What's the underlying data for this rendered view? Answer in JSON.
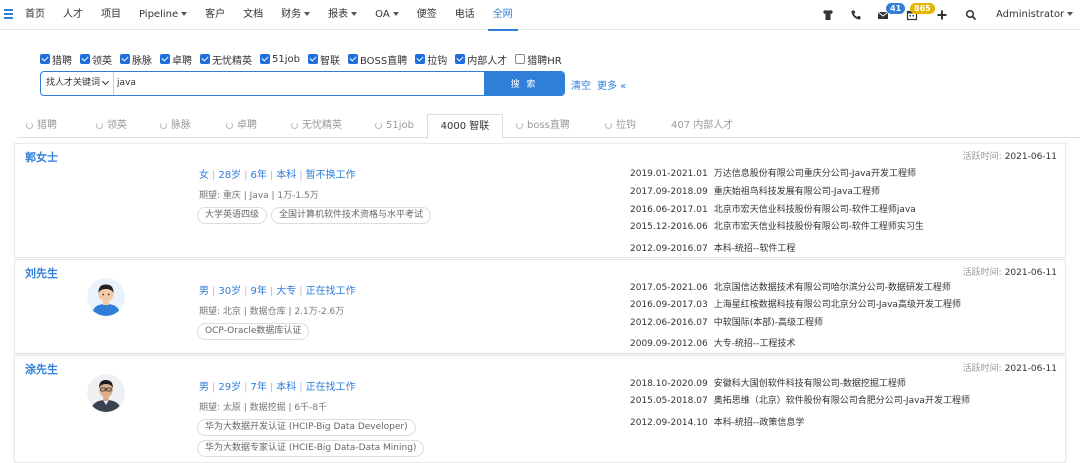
{
  "nav": {
    "items": [
      {
        "label": "首页",
        "caret": false
      },
      {
        "label": "人才",
        "caret": false
      },
      {
        "label": "项目",
        "caret": false
      },
      {
        "label": "Pipeline",
        "caret": true
      },
      {
        "label": "客户",
        "caret": false
      },
      {
        "label": "文档",
        "caret": false
      },
      {
        "label": "财务",
        "caret": true
      },
      {
        "label": "报表",
        "caret": true
      },
      {
        "label": "OA",
        "caret": true
      },
      {
        "label": "便签",
        "caret": false
      },
      {
        "label": "电话",
        "caret": false
      },
      {
        "label": "全网",
        "caret": false,
        "active": true
      }
    ],
    "message_badge": "41",
    "calendar_badge": "865",
    "user": "Administrator",
    "accent_color": "#2f7ed8"
  },
  "sources": [
    {
      "label": "猎聘",
      "checked": true
    },
    {
      "label": "领英",
      "checked": true
    },
    {
      "label": "脉脉",
      "checked": true
    },
    {
      "label": "卓聘",
      "checked": true
    },
    {
      "label": "无忧精英",
      "checked": true
    },
    {
      "label": "51job",
      "checked": true
    },
    {
      "label": "智联",
      "checked": true
    },
    {
      "label": "BOSS直聘",
      "checked": true
    },
    {
      "label": "拉钩",
      "checked": true
    },
    {
      "label": "内部人才",
      "checked": true
    },
    {
      "label": "猎聘HR",
      "checked": false
    }
  ],
  "search": {
    "field_select": "找人才关键词",
    "keyword": "java",
    "button_label": "搜 索",
    "clear_label": "清空",
    "more_label": "更多 «"
  },
  "tabs": [
    {
      "label": "猎聘",
      "loading": true
    },
    {
      "label": "领英",
      "loading": true
    },
    {
      "label": "脉脉",
      "loading": true
    },
    {
      "label": "卓聘",
      "loading": true
    },
    {
      "label": "无忧精英",
      "loading": true
    },
    {
      "label": "51job",
      "loading": true
    },
    {
      "label": "4000 智联",
      "loading": false,
      "active": true
    },
    {
      "label": "boss直聘",
      "loading": true
    },
    {
      "label": "拉钩",
      "loading": true
    },
    {
      "label": "407 内部人才",
      "loading": false
    }
  ],
  "active_time_label": "活跃时间:",
  "candidates": [
    {
      "name": "郭女士",
      "avatar": "blank",
      "summary": [
        "女",
        "28岁",
        "6年",
        "本科",
        "暂不换工作"
      ],
      "expect": "期望: 重庆 | Java | 1万-1.5万",
      "tags": [
        "大学英语四级",
        "全国计算机软件技术资格与水平考试"
      ],
      "active_time": "2021-06-11",
      "experiences": [
        {
          "date": "2019.01-2021.01",
          "text": "万达信息股份有限公司重庆分公司-Java开发工程师"
        },
        {
          "date": "2017.09-2018.09",
          "text": "重庆始祖鸟科技发展有限公司-Java工程师"
        },
        {
          "date": "2016.06-2017.01",
          "text": "北京市宏天信业科技股份有限公司-软件工程师java"
        },
        {
          "date": "2015.12-2016.06",
          "text": "北京市宏天信业科技股份有限公司-软件工程师实习生"
        }
      ],
      "education": {
        "date": "2012.09-2016.07",
        "text": "本科-统招--软件工程"
      }
    },
    {
      "name": "刘先生",
      "avatar": "cartoon-male",
      "summary": [
        "男",
        "30岁",
        "9年",
        "大专",
        "正在找工作"
      ],
      "expect": "期望: 北京 | 数据仓库 | 2.1万-2.6万",
      "tags": [
        "OCP-Oracle数据库认证"
      ],
      "active_time": "2021-06-11",
      "experiences": [
        {
          "date": "2017.05-2021.06",
          "text": "北京国信达数据技术有限公司哈尔滨分公司-数据研发工程师"
        },
        {
          "date": "2016.09-2017.03",
          "text": "上海星红桉数据科技有限公司北京分公司-Java高级开发工程师"
        },
        {
          "date": "2012.06-2016.07",
          "text": "中软国际(本部)-高级工程师"
        }
      ],
      "education": {
        "date": "2009.09-2012.06",
        "text": "大专-统招--工程技术"
      }
    },
    {
      "name": "涂先生",
      "avatar": "photo-male",
      "summary": [
        "男",
        "29岁",
        "7年",
        "本科",
        "正在找工作"
      ],
      "expect": "期望: 太原 | 数据挖掘 | 6千-8千",
      "tags": [
        "华为大数据开发认证 (HCIP-Big Data Developer)",
        "华为大数据专家认证 (HCIE-Big Data-Data Mining)"
      ],
      "active_time": "2021-06-11",
      "experiences": [
        {
          "date": "2018.10-2020.09",
          "text": "安徽科大国创软件科技有限公司-数据挖掘工程师"
        },
        {
          "date": "2015.05-2018.07",
          "text": "奥拓思维（北京）软件股份有限公司合肥分公司-Java开发工程师"
        }
      ],
      "education": {
        "date": "2012.09-2014.10",
        "text": "本科-统招--政策信息学"
      }
    }
  ]
}
